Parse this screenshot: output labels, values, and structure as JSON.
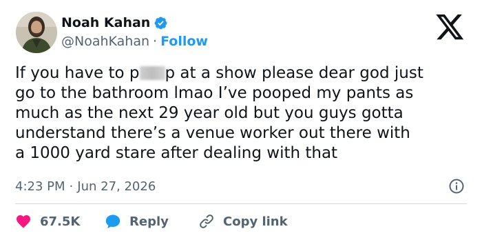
{
  "author": {
    "display_name": "Noah Kahan",
    "handle": "@NoahKahan",
    "separator": "·",
    "follow_label": "Follow",
    "verified_color": "#1d9bf0"
  },
  "tweet": {
    "text_before_redaction": "If you have to p",
    "text_after_redaction": "p at a show please dear god just\ngo to the bathroom lmao I’ve pooped my pants as\nmuch as the next 29 year old but you guys gotta\nunderstand there’s a venue worker out there with\na 1000 yard stare after dealing with that",
    "time": "4:23 PM",
    "separator": "·",
    "date": "Jun 27, 2026"
  },
  "actions": {
    "like_count": "67.5K",
    "reply_label": "Reply",
    "copy_link_label": "Copy link"
  },
  "colors": {
    "text_primary": "#0f1419",
    "text_secondary": "#536471",
    "accent": "#1d9bf0",
    "like": "#f91880",
    "divider": "#cfd9de"
  },
  "icons": {
    "brand": "x-logo-icon",
    "verified": "verified-badge-icon",
    "info": "info-icon",
    "like": "heart-icon",
    "reply": "reply-bubble-icon",
    "copy_link": "link-icon"
  }
}
